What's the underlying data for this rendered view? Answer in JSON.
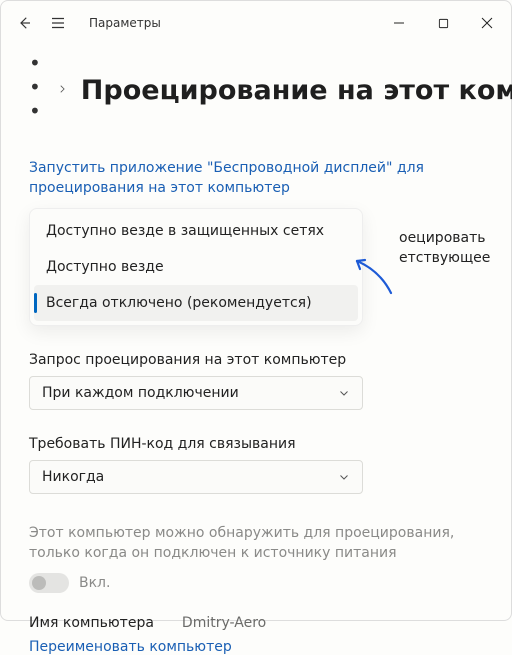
{
  "titlebar": {
    "title": "Параметры"
  },
  "breadcrumb": {
    "dots": "• • •"
  },
  "page": {
    "title": "Проецирование на этот компью"
  },
  "link": {
    "launch_app": "Запустить приложение \"Беспроводной дисплей\" для проецирования на этот компьютер"
  },
  "dropdown1": {
    "options": [
      "Доступно везде в защищенных сетях",
      "Доступно везде",
      "Всегда отключено (рекомендуется)"
    ],
    "overflow_line1": "оецировать",
    "overflow_line2": "етствующее"
  },
  "field2": {
    "label": "Запрос проецирования на этот компьютер",
    "value": "При каждом подключении"
  },
  "field3": {
    "label": "Требовать ПИН-код для связывания",
    "value": "Никогда"
  },
  "discover": {
    "note": "Этот компьютер можно обнаружить для проецирования, только когда он подключен к источнику питания",
    "toggle_label": "Вкл."
  },
  "pc_name": {
    "label": "Имя компьютера",
    "value": "Dmitry-Aero"
  },
  "rename": {
    "label": "Переименовать компьютер"
  }
}
